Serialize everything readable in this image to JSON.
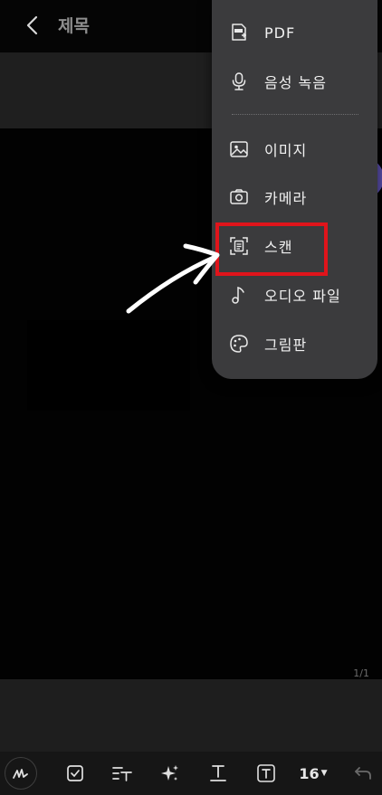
{
  "header": {
    "title": "제목"
  },
  "page": {
    "page_indicator": "1/1"
  },
  "attach_menu": {
    "items": [
      {
        "label": "PDF",
        "icon": "pdf-icon"
      },
      {
        "label": "음성 녹음",
        "icon": "microphone-icon"
      },
      {
        "label": "이미지",
        "icon": "image-icon"
      },
      {
        "label": "카메라",
        "icon": "camera-icon"
      },
      {
        "label": "스캔",
        "icon": "scan-icon"
      },
      {
        "label": "오디오 파일",
        "icon": "music-note-icon"
      },
      {
        "label": "그림판",
        "icon": "palette-icon"
      }
    ],
    "highlighted_item": "스캔"
  },
  "toolbar": {
    "font_size": "16",
    "icons": [
      "handwriting-icon",
      "checkbox-icon",
      "text-style-icon",
      "ai-sparkle-icon",
      "text-underline-icon",
      "text-box-icon",
      "font-size-dropdown",
      "undo-icon"
    ]
  },
  "colors": {
    "background": "#040404",
    "menu_background": "#3b3b3d",
    "highlight": "#e0141b",
    "fab": "#5a4fae"
  }
}
